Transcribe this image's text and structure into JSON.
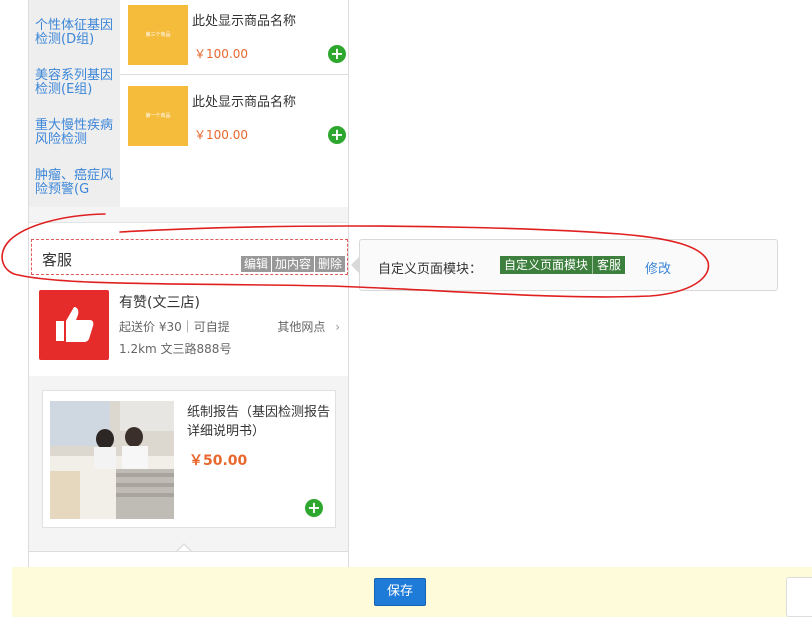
{
  "categories": {
    "items": [
      {
        "label": "个性体征基因检测(D组)"
      },
      {
        "label": "美容系列基因检测(E组)"
      },
      {
        "label": "重大慢性疾病风险检测"
      },
      {
        "label": "肿瘤、癌症风险预警(G"
      }
    ]
  },
  "products": [
    {
      "thumb_text": "第三个商品",
      "name": "此处显示商品名称",
      "price": "￥100.00",
      "add_icon": "plus-circle-icon"
    },
    {
      "thumb_text": "第一个商品",
      "name": "此处显示商品名称",
      "price": "￥100.00",
      "add_icon": "plus-circle-icon"
    }
  ],
  "kefu": {
    "title": "客服",
    "edit_label": "编辑",
    "add_label": "加内容",
    "delete_label": "删除"
  },
  "store": {
    "logo_icon": "thumbs-up-icon",
    "name": "有赞(文三店)",
    "info": "起送价 ¥30｜可自提",
    "distance_address": "1.2km   文三路888号",
    "other_label": "其他网点",
    "other_icon": "chevron-right-icon"
  },
  "report": {
    "name": "纸制报告（基因检测报告详细说明书）",
    "price": "￥50.00",
    "add_icon": "plus-circle-icon"
  },
  "panel": {
    "label": "自定义页面模块：",
    "tags": [
      "自定义页面模块",
      "客服"
    ],
    "edit_link": "修改"
  },
  "footer": {
    "save_label": "保存"
  },
  "colors": {
    "accent": "#1e7bd7",
    "price": "#e8672d",
    "link": "#3c86d8",
    "tag_bg": "#3d7f3d",
    "annotation": "#e02020"
  }
}
